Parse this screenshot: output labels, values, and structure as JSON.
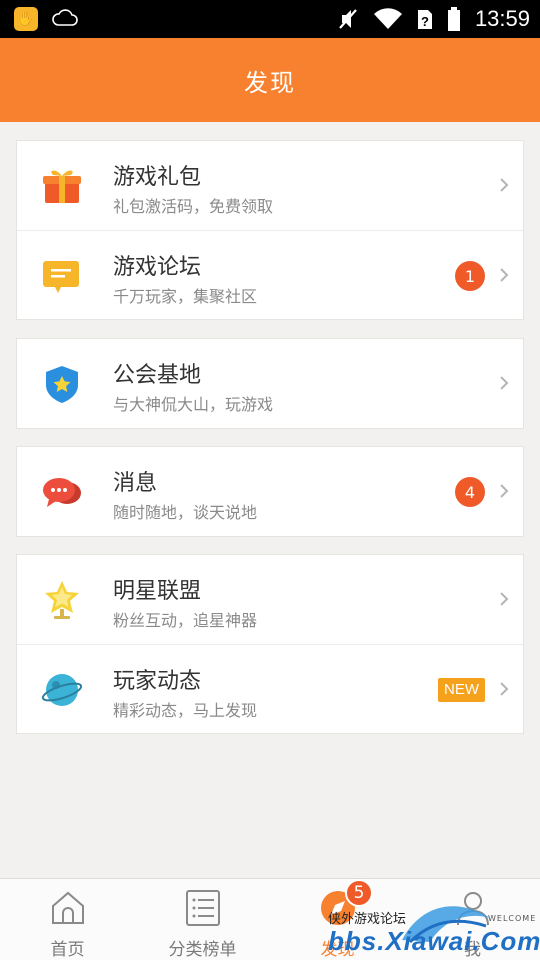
{
  "status_bar": {
    "time": "13:59"
  },
  "header": {
    "title": "发现"
  },
  "groups": [
    [
      {
        "title": "游戏礼包",
        "subtitle": "礼包激活码，免费领取"
      },
      {
        "title": "游戏论坛",
        "subtitle": "千万玩家，集聚社区",
        "badge": "1"
      }
    ],
    [
      {
        "title": "公会基地",
        "subtitle": "与大神侃大山，玩游戏"
      }
    ],
    [
      {
        "title": "消息",
        "subtitle": "随时随地，谈天说地",
        "badge": "4"
      }
    ],
    [
      {
        "title": "明星联盟",
        "subtitle": "粉丝互动，追星神器"
      },
      {
        "title": "玩家动态",
        "subtitle": "精彩动态，马上发现",
        "tag": "NEW"
      }
    ]
  ],
  "bottom_nav": {
    "items": [
      {
        "label": "首页"
      },
      {
        "label": "分类榜单"
      },
      {
        "label": "发现",
        "badge": "5",
        "active": true
      },
      {
        "label": "我"
      }
    ]
  },
  "watermark": {
    "site_name": "侠外游戏论坛",
    "url": "bbs.Xiawai.Com",
    "welcome": "WELCOME"
  },
  "colors": {
    "accent": "#f7812e",
    "badge": "#f05a28",
    "new_tag": "#f5a11c"
  }
}
